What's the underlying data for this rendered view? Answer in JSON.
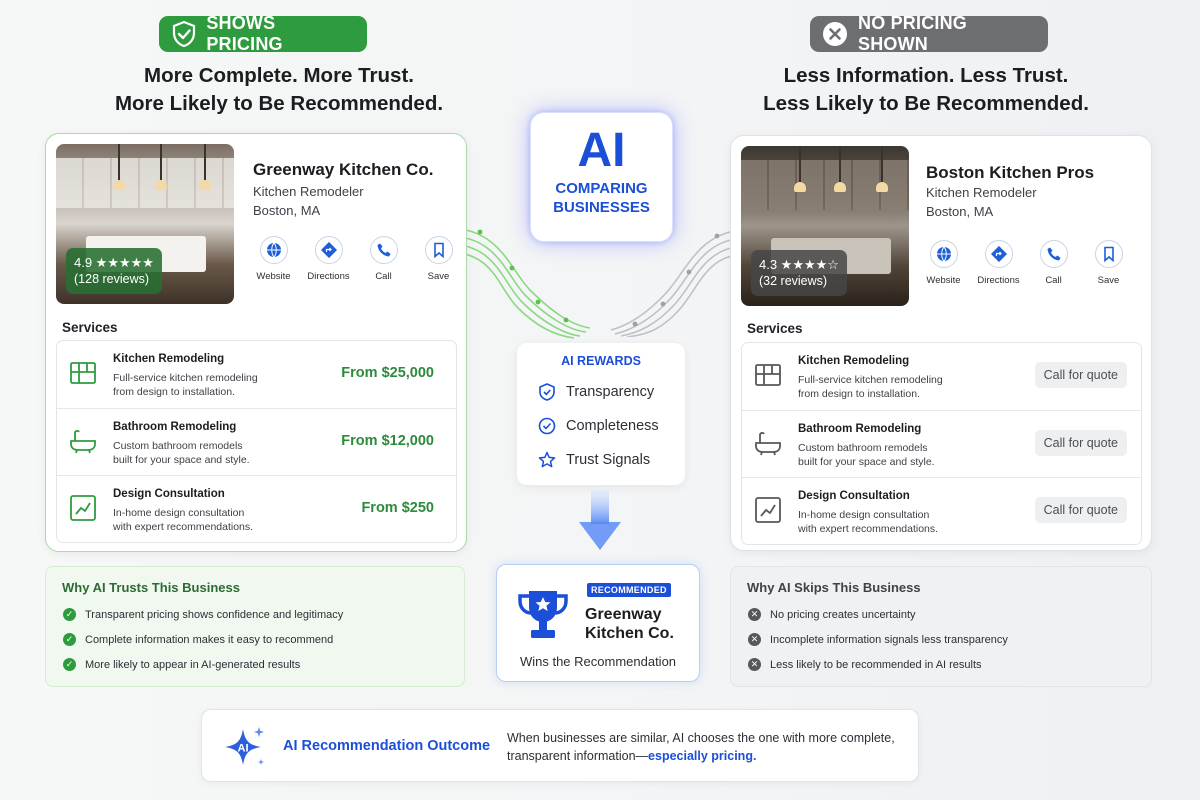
{
  "left": {
    "badge": "SHOWS PRICING",
    "headline_1": "More Complete. More Trust.",
    "headline_2": "More Likely to Be Recommended.",
    "business": {
      "name": "Greenway Kitchen Co.",
      "category": "Kitchen Remodeler",
      "location": "Boston, MA",
      "rating": "4.9 ★★★★★",
      "reviews": "(128 reviews)"
    },
    "actions": [
      "Website",
      "Directions",
      "Call",
      "Save"
    ],
    "services_title": "Services",
    "services": [
      {
        "name": "Kitchen Remodeling",
        "desc_1": "Full-service kitchen remodeling",
        "desc_2": "from design to installation.",
        "price": "From $25,000"
      },
      {
        "name": "Bathroom Remodeling",
        "desc_1": "Custom bathroom remodels",
        "desc_2": "built for your space and style.",
        "price": "From $12,000"
      },
      {
        "name": "Design Consultation",
        "desc_1": "In-home design consultation",
        "desc_2": "with expert recommendations.",
        "price": "From $250"
      }
    ],
    "panel_title": "Why AI Trusts This Business",
    "panel_items": [
      "Transparent pricing shows confidence and legitimacy",
      "Complete information makes it easy to recommend",
      "More likely to appear in AI-generated results"
    ]
  },
  "right": {
    "badge": "NO PRICING SHOWN",
    "headline_1": "Less Information. Less Trust.",
    "headline_2": "Less Likely to Be Recommended.",
    "business": {
      "name": "Boston Kitchen Pros",
      "category": "Kitchen Remodeler",
      "location": "Boston, MA",
      "rating": "4.3 ★★★★☆",
      "reviews": "(32 reviews)"
    },
    "actions": [
      "Website",
      "Directions",
      "Call",
      "Save"
    ],
    "services_title": "Services",
    "services": [
      {
        "name": "Kitchen Remodeling",
        "desc_1": "Full-service kitchen remodeling",
        "desc_2": "from design to installation.",
        "cta": "Call for quote"
      },
      {
        "name": "Bathroom Remodeling",
        "desc_1": "Custom bathroom remodels",
        "desc_2": "built for your space and style.",
        "cta": "Call for quote"
      },
      {
        "name": "Design Consultation",
        "desc_1": "In-home design consultation",
        "desc_2": "with expert recommendations.",
        "cta": "Call for quote"
      }
    ],
    "panel_title": "Why AI Skips This Business",
    "panel_items": [
      "No pricing creates uncertainty",
      "Incomplete information signals less transparency",
      "Less likely to be recommended in AI results"
    ]
  },
  "center": {
    "ai_title": "AI",
    "ai_sub_1": "COMPARING",
    "ai_sub_2": "BUSINESSES",
    "rewards_title": "AI REWARDS",
    "rewards": [
      "Transparency",
      "Completeness",
      "Trust Signals"
    ],
    "rec_badge": "RECOMMENDED",
    "rec_name_1": "Greenway",
    "rec_name_2": "Kitchen Co.",
    "rec_sub": "Wins the Recommendation"
  },
  "outcome": {
    "sparkle_label": "AI",
    "title": "AI Recommendation Outcome",
    "text_1": "When businesses are similar, AI chooses the one with more complete,",
    "text_2": "transparent information—",
    "text_highlight": "especially pricing."
  },
  "colors": {
    "green": "#2e9c3e",
    "gray": "#6c6e72",
    "blue": "#1c4fd8",
    "price_green": "#2d8a3a"
  },
  "icons": {
    "left_badge": "shield-check-icon",
    "right_badge": "x-circle-icon",
    "actions": [
      "globe-icon",
      "directions-icon",
      "phone-icon",
      "bookmark-icon"
    ],
    "services": [
      "kitchen-icon",
      "bathtub-icon",
      "design-chart-icon"
    ],
    "rewards": [
      "shield-icon",
      "check-circle-icon",
      "star-icon"
    ]
  }
}
